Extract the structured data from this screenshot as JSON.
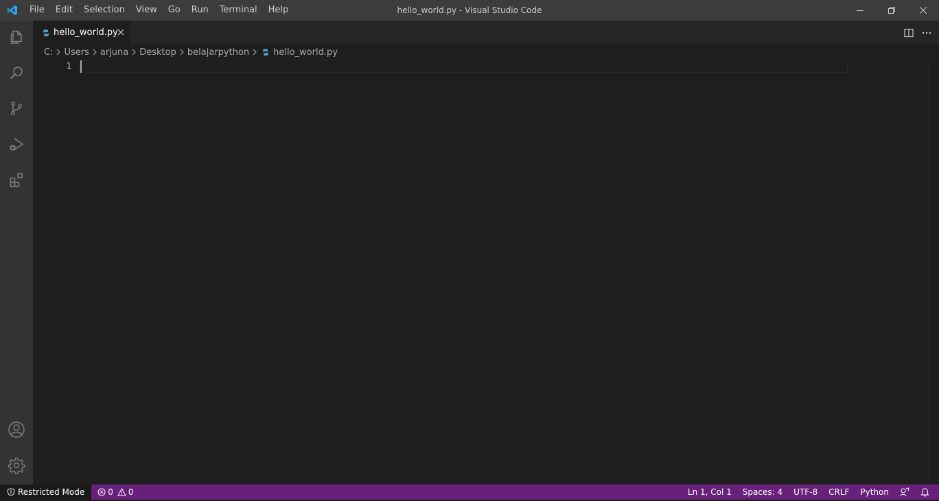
{
  "titlebar": {
    "menu": [
      "File",
      "Edit",
      "Selection",
      "View",
      "Go",
      "Run",
      "Terminal",
      "Help"
    ],
    "title": "hello_world.py - Visual Studio Code"
  },
  "activitybar": {
    "top_icons": [
      "files-icon",
      "search-icon",
      "source-control-icon",
      "run-debug-icon",
      "extensions-icon"
    ],
    "bottom_icons": [
      "account-icon",
      "settings-gear-icon"
    ]
  },
  "tab": {
    "label": "hello_world.py"
  },
  "breadcrumb": {
    "items": [
      "C:",
      "Users",
      "arjuna",
      "Desktop",
      "belajarpython",
      "hello_world.py"
    ]
  },
  "editor": {
    "line_number": "1"
  },
  "statusbar": {
    "restricted": "Restricted Mode",
    "errors": "0",
    "warnings": "0",
    "position": "Ln 1, Col 1",
    "spaces": "Spaces: 4",
    "encoding": "UTF-8",
    "eol": "CRLF",
    "language": "Python"
  },
  "colors": {
    "accent": "#68217a",
    "python_icon": "#519aba",
    "vscode_logo": "#23a9f2"
  }
}
